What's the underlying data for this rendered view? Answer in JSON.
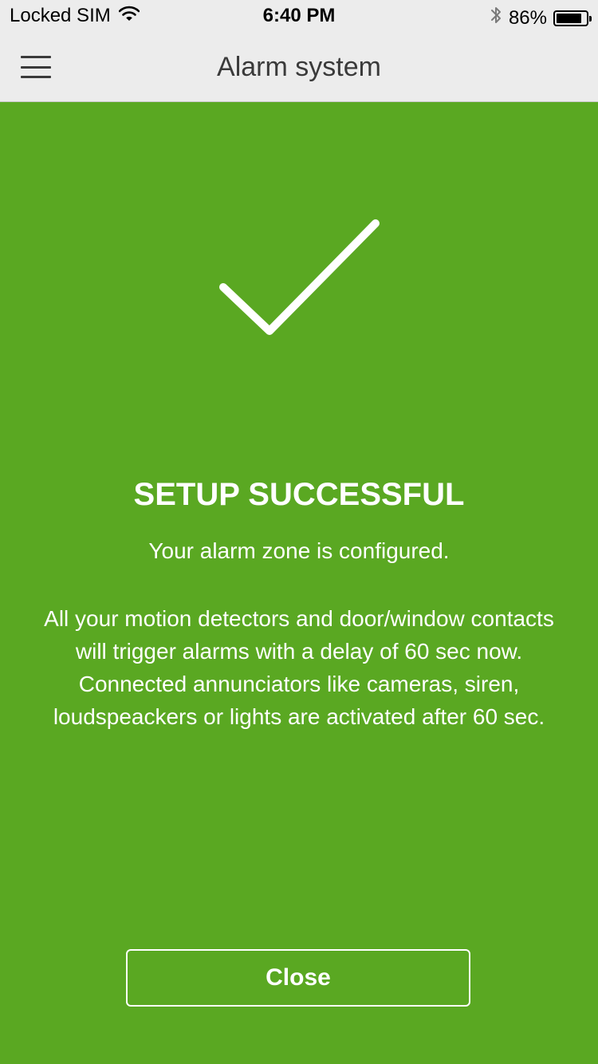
{
  "status_bar": {
    "carrier": "Locked SIM",
    "time": "6:40 PM",
    "battery_percent": "86%",
    "battery_level": 0.86,
    "icons": [
      "wifi-icon",
      "bluetooth-icon",
      "battery-icon"
    ]
  },
  "nav": {
    "title": "Alarm system",
    "menu_icon": "hamburger-menu-icon"
  },
  "content": {
    "icon": "checkmark-icon",
    "headline": "SETUP SUCCESSFUL",
    "subline": "Your alarm zone is configured.",
    "description_lines": [
      "All your motion detectors and door/window contacts",
      "will trigger alarms with a delay of 60 sec now.",
      "Connected annunciators like cameras, siren,",
      "loudspeackers or lights are activated after 60 sec."
    ]
  },
  "actions": {
    "close_label": "Close"
  },
  "colors": {
    "background": "#5aa822",
    "bar": "#ececec",
    "text_on_green": "#ffffff"
  }
}
